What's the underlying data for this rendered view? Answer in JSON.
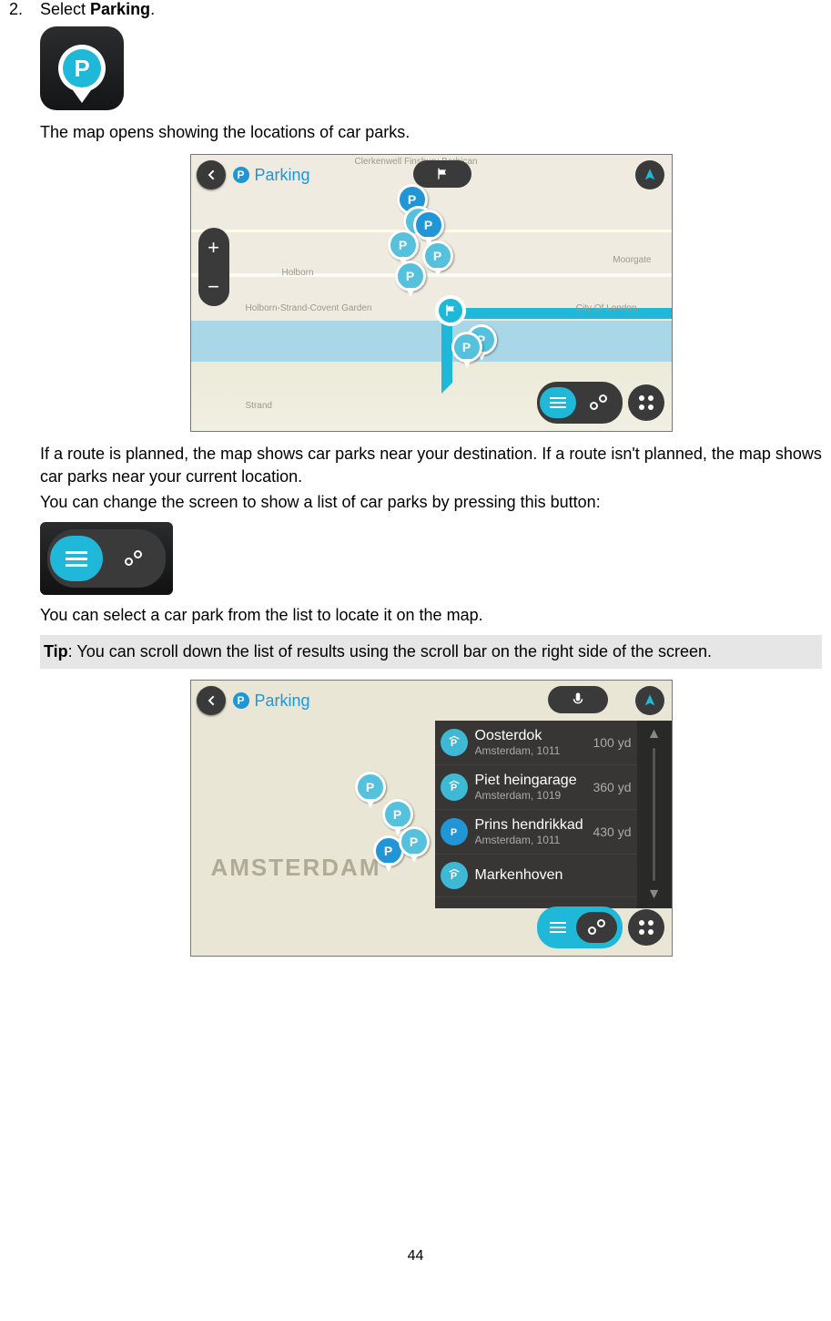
{
  "step": {
    "number": "2.",
    "prefix": "Select ",
    "bold": "Parking",
    "suffix": "."
  },
  "para1": "The map opens showing the locations of car parks.",
  "para2": "If a route is planned, the map shows car parks near your destination. If a route isn't planned, the map shows car parks near your current location.",
  "para3": "You can change the screen to show a list of car parks by pressing this button:",
  "para4": "You can select a car park from the list to locate it on the map.",
  "tip_label": "Tip",
  "tip_text": ": You can scroll down the list of results using the scroll bar on the right side of the screen.",
  "map1": {
    "title": "Parking",
    "labels": {
      "holborn": "Holborn",
      "strand": "Holborn-Strand-Covent Garden",
      "moorgate": "Moorgate",
      "city": "City Of London",
      "top": "Clerkenwell   Finsbury   Barbican",
      "strand2": "Strand"
    }
  },
  "map2": {
    "title": "Parking",
    "city_label": "AMSTERDAM",
    "results": [
      {
        "name": "Oosterdok",
        "sub": "Amsterdam, 1011",
        "dist": "100 yd",
        "covered": true
      },
      {
        "name": "Piet heingarage",
        "sub": "Amsterdam, 1019",
        "dist": "360 yd",
        "covered": true
      },
      {
        "name": "Prins hendrikkad",
        "sub": "Amsterdam, 1011",
        "dist": "430 yd",
        "covered": false
      },
      {
        "name": "Markenhoven",
        "sub": "",
        "dist": "",
        "covered": true
      }
    ]
  },
  "page_number": "44"
}
